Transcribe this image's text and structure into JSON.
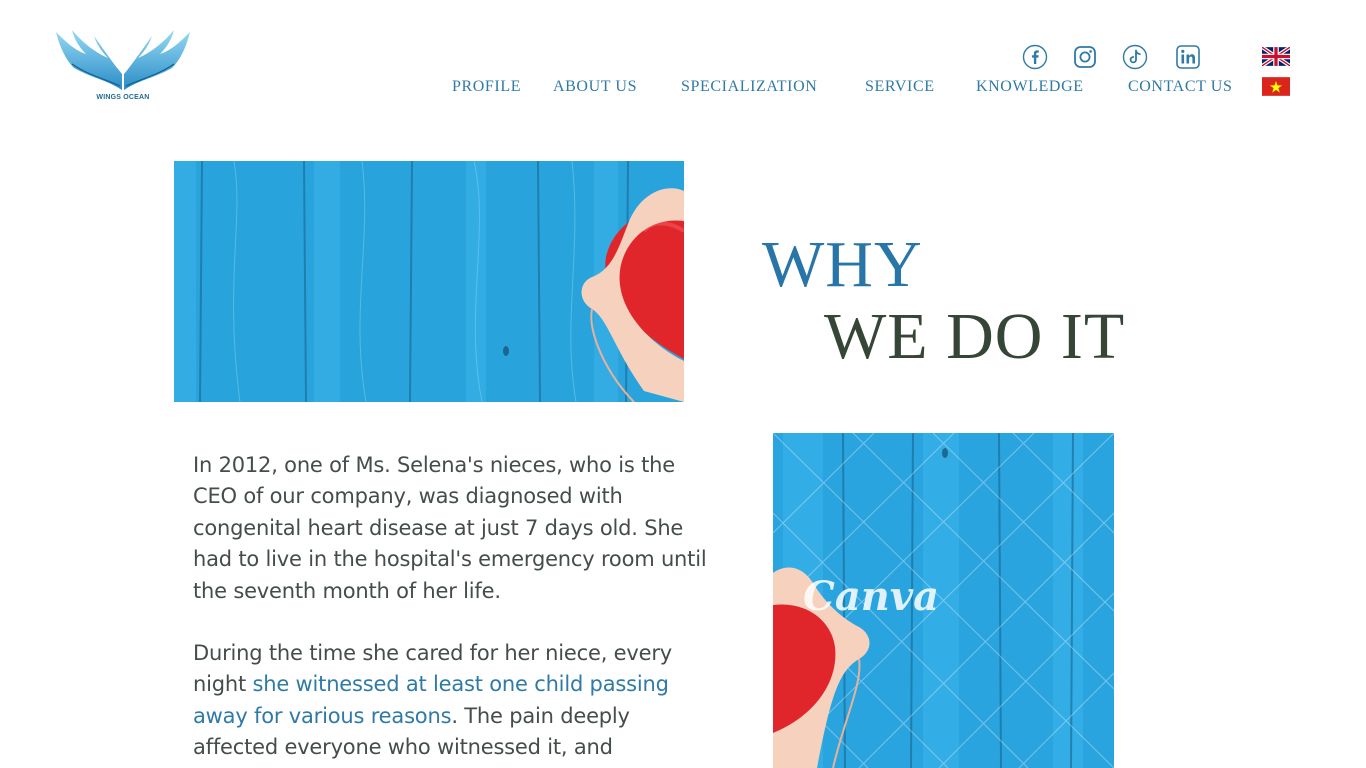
{
  "brand": {
    "name": "WINGS OCEAN"
  },
  "nav": {
    "items": [
      {
        "key": "profile",
        "label": "PROFILE"
      },
      {
        "key": "about",
        "label": "ABOUT US"
      },
      {
        "key": "specialization",
        "label": "SPECIALIZATION"
      },
      {
        "key": "service",
        "label": "SERVICE"
      },
      {
        "key": "knowledge",
        "label": "KNOWLEDGE"
      },
      {
        "key": "contact",
        "label": "CONTACT US"
      }
    ]
  },
  "social": [
    "facebook-icon",
    "instagram-icon",
    "tiktok-icon",
    "linkedin-icon"
  ],
  "languages": [
    "uk-flag-icon",
    "vietnam-flag-icon"
  ],
  "heading": {
    "line1": "WHY",
    "line2": "WE DO IT"
  },
  "body": {
    "p1": "In 2012, one of Ms. Selena's nieces, who is the CEO of our company, was diagnosed with congenital heart disease at just 7 days old. She had to live in the hospital's emergency room until the seventh month of her life.",
    "p2_start": "During the time she cared for her niece, every night ",
    "p2_highlight": "she witnessed at least one child passing away for various reasons",
    "p2_end": ". The pain deeply affected everyone who witnessed it, and"
  },
  "watermark": "Canva",
  "colors": {
    "accent": "#2f7aa6",
    "heading_dark": "#354636",
    "wood_blue": "#29a3dc",
    "heart_red": "#e0262b"
  }
}
